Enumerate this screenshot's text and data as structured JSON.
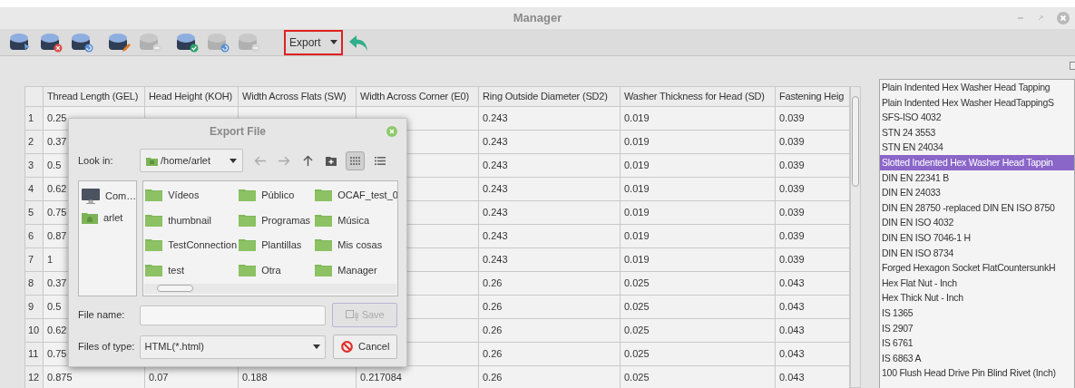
{
  "window": {
    "title": "Manager"
  },
  "toolbar": {
    "buttons": [
      {
        "kind": "pointer",
        "disabled": false
      },
      {
        "kind": "delete",
        "disabled": false
      },
      {
        "kind": "refresh",
        "disabled": false
      },
      {
        "kind": "edit",
        "disabled": false
      },
      {
        "kind": "remove",
        "disabled": true
      },
      {
        "kind": "confirm",
        "disabled": false
      },
      {
        "kind": "refresh",
        "disabled": true
      },
      {
        "kind": "remove",
        "disabled": true
      }
    ],
    "export_combo": {
      "value": "Export",
      "highlighted": true
    }
  },
  "table": {
    "columns": [
      "Thread Length (GEL)",
      "Head Height (KOH)",
      "Width Across Flats (SW)",
      "Width Across Corner (E0)",
      "Ring Outside Diameter (SD2)",
      "Washer Thickness for Head (SD)",
      "Fastening Heig"
    ],
    "rows": [
      {
        "number": "1",
        "cells": [
          "0.25",
          null,
          null,
          null,
          "0.243",
          "0.019",
          "0.039"
        ]
      },
      {
        "number": "2",
        "cells": [
          "0.37",
          null,
          null,
          null,
          "0.243",
          "0.019",
          "0.039"
        ]
      },
      {
        "number": "3",
        "cells": [
          "0.5",
          null,
          null,
          null,
          "0.243",
          "0.019",
          "0.039"
        ]
      },
      {
        "number": "4",
        "cells": [
          "0.62",
          null,
          null,
          null,
          "0.243",
          "0.019",
          "0.039"
        ]
      },
      {
        "number": "5",
        "cells": [
          "0.75",
          null,
          null,
          null,
          "0.243",
          "0.019",
          "0.039"
        ]
      },
      {
        "number": "6",
        "cells": [
          "0.87",
          null,
          null,
          null,
          "0.243",
          "0.019",
          "0.039"
        ]
      },
      {
        "number": "7",
        "cells": [
          "1",
          null,
          null,
          null,
          "0.243",
          "0.019",
          "0.039"
        ]
      },
      {
        "number": "8",
        "cells": [
          "0.37",
          null,
          null,
          null,
          "0.26",
          "0.025",
          "0.043"
        ]
      },
      {
        "number": "9",
        "cells": [
          "0.5",
          null,
          null,
          null,
          "0.26",
          "0.025",
          "0.043"
        ]
      },
      {
        "number": "10",
        "cells": [
          "0.62",
          null,
          null,
          null,
          "0.26",
          "0.025",
          "0.043"
        ]
      },
      {
        "number": "11",
        "cells": [
          "0.75",
          null,
          null,
          null,
          "0.26",
          "0.025",
          "0.043"
        ]
      },
      {
        "number": "12",
        "cells": [
          "0.875",
          "0.07",
          "0.188",
          "0.217084",
          "0.26",
          "0.025",
          "0.043"
        ]
      }
    ]
  },
  "standards_list": {
    "items": [
      {
        "label": "Plain Indented Hex Washer Head Tapping",
        "selected": false
      },
      {
        "label": "Plain Indented Hex Washer HeadTappingS",
        "selected": false
      },
      {
        "label": "SFS-ISO 4032",
        "selected": false
      },
      {
        "label": "STN 24 3553",
        "selected": false
      },
      {
        "label": "STN EN 24034",
        "selected": false
      },
      {
        "label": "Slotted Indented Hex Washer Head Tappin",
        "selected": true
      },
      {
        "label": "DIN EN 22341 B",
        "selected": false
      },
      {
        "label": "DIN EN 24033",
        "selected": false
      },
      {
        "label": "DIN EN 28750 -replaced DIN EN ISO 8750",
        "selected": false
      },
      {
        "label": "DIN EN ISO 4032",
        "selected": false
      },
      {
        "label": "DIN EN ISO 7046-1 H",
        "selected": false
      },
      {
        "label": "DIN EN ISO 8734",
        "selected": false
      },
      {
        "label": "Forged Hexagon Socket FlatCountersunkH",
        "selected": false
      },
      {
        "label": "Hex Flat Nut - Inch",
        "selected": false
      },
      {
        "label": "Hex Thick Nut - Inch",
        "selected": false
      },
      {
        "label": "IS 1365",
        "selected": false
      },
      {
        "label": "IS 2907",
        "selected": false
      },
      {
        "label": "IS 6761",
        "selected": false
      },
      {
        "label": "IS 6863 A",
        "selected": false
      },
      {
        "label": "100 Flush Head Drive Pin Blind Rivet (Inch)",
        "selected": false
      }
    ]
  },
  "dialog": {
    "title": "Export File",
    "look_in_label": "Look in:",
    "path": "/home/arlet",
    "places": [
      {
        "label": "Com…",
        "kind": "computer"
      },
      {
        "label": "arlet",
        "kind": "home"
      }
    ],
    "files": [
      "Vídeos",
      "Público",
      "OCAF_test_0",
      "thumbnail",
      "Programas",
      "Música",
      "TestConnection",
      "Plantillas",
      "Mis cosas",
      "test",
      "Otra",
      "Manager"
    ],
    "icon_view": true,
    "file_name_label": "File name:",
    "save_button": {
      "label": "Save",
      "disabled": true
    },
    "file_type_label": "Files of type:",
    "file_type": "HTML(*.html)",
    "cancel_button": {
      "label": "Cancel"
    }
  }
}
